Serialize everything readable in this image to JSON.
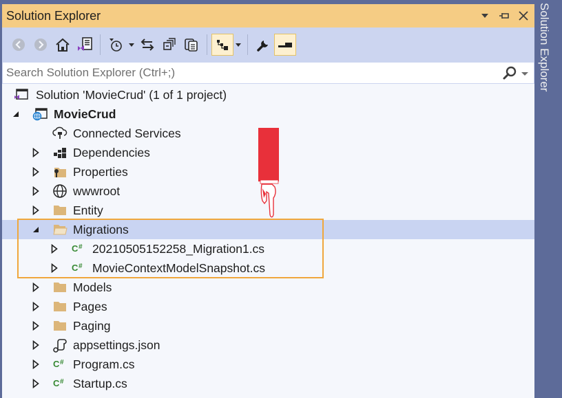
{
  "window": {
    "title": "Solution Explorer",
    "controls": [
      "dropdown-arrow",
      "pin",
      "close"
    ]
  },
  "side_tab": {
    "label": "Solution Explorer"
  },
  "toolbar": {
    "buttons": [
      {
        "name": "back",
        "icon": "back-arrow-icon",
        "enabled": false
      },
      {
        "name": "forward",
        "icon": "forward-arrow-icon",
        "enabled": false
      },
      {
        "name": "home",
        "icon": "home-icon"
      },
      {
        "name": "switch-views",
        "icon": "switch-views-icon"
      },
      {
        "name": "pending-changes-filter",
        "icon": "clock-filter-icon",
        "has_dropdown": true
      },
      {
        "name": "sync-with-active-document",
        "icon": "sync-arrows-icon"
      },
      {
        "name": "collapse-all",
        "icon": "collapse-all-icon"
      },
      {
        "name": "show-all-files",
        "icon": "show-all-files-icon"
      },
      {
        "name": "preview-selected-items",
        "icon": "tree-view-icon",
        "active": true,
        "has_dropdown": true
      },
      {
        "name": "properties",
        "icon": "wrench-icon"
      },
      {
        "name": "preview",
        "icon": "preview-toggle-icon",
        "active": true
      }
    ]
  },
  "search": {
    "placeholder": "Search Solution Explorer (Ctrl+;)",
    "value": ""
  },
  "tree": {
    "solution": "Solution 'MovieCrud' (1 of 1 project)",
    "project": "MovieCrud",
    "items": [
      {
        "label": "Connected Services",
        "icon": "cloud-plug-icon",
        "expandable": false
      },
      {
        "label": "Dependencies",
        "icon": "dependencies-icon",
        "expandable": true
      },
      {
        "label": "Properties",
        "icon": "properties-folder-icon",
        "expandable": true
      },
      {
        "label": "wwwroot",
        "icon": "globe-icon",
        "expandable": true
      },
      {
        "label": "Entity",
        "icon": "folder-icon",
        "expandable": true
      },
      {
        "label": "Migrations",
        "icon": "folder-open-icon",
        "expandable": true,
        "expanded": true,
        "selected": true,
        "children": [
          {
            "label": "20210505152258_Migration1.cs",
            "icon": "csharp-file-icon"
          },
          {
            "label": "MovieContextModelSnapshot.cs",
            "icon": "csharp-file-icon"
          }
        ]
      },
      {
        "label": "Models",
        "icon": "folder-icon",
        "expandable": true
      },
      {
        "label": "Pages",
        "icon": "folder-icon",
        "expandable": true
      },
      {
        "label": "Paging",
        "icon": "folder-icon",
        "expandable": true
      },
      {
        "label": "appsettings.json",
        "icon": "json-file-icon",
        "expandable": true
      },
      {
        "label": "Program.cs",
        "icon": "csharp-file-icon",
        "expandable": true
      },
      {
        "label": "Startup.cs",
        "icon": "csharp-file-icon",
        "expandable": true
      }
    ]
  },
  "colors": {
    "title_bar": "#f5cc84",
    "toolbar": "#ccd5f0",
    "selection": "#c9d4f2",
    "highlight_box": "#f0a73c",
    "csharp_icon": "#388a34",
    "folder": "#dcb67a",
    "frame": "#5d6b99",
    "annotation_pointer": "#e8303a"
  },
  "annotation": {
    "pointer": "pointing-hand pointing down at Migrations folder",
    "highlight": "orange box around Migrations folder and its files"
  }
}
